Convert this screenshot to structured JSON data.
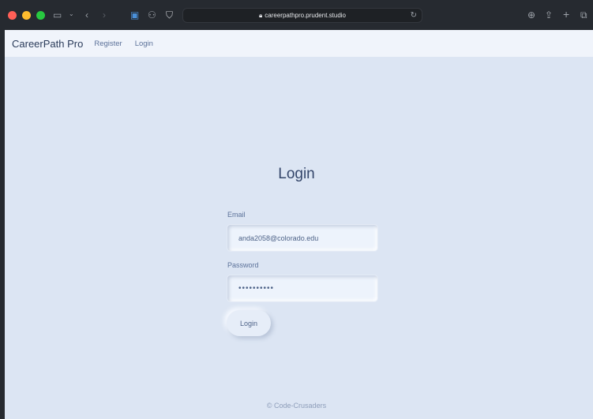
{
  "browser": {
    "url": "careerpathpro.prudent.studio"
  },
  "nav": {
    "brand": "CareerPath Pro",
    "links": [
      {
        "label": "Register"
      },
      {
        "label": "Login"
      }
    ]
  },
  "form": {
    "title": "Login",
    "email_label": "Email",
    "email_value": "anda2058@colorado.edu",
    "password_label": "Password",
    "password_value": "••••••••••",
    "submit_label": "Login"
  },
  "footer": {
    "text": "© Code-Crusaders"
  },
  "colors": {
    "background": "#dce5f3",
    "navbar": "#f0f4fb",
    "text_primary": "#34466a",
    "text_secondary": "#5b7199"
  }
}
